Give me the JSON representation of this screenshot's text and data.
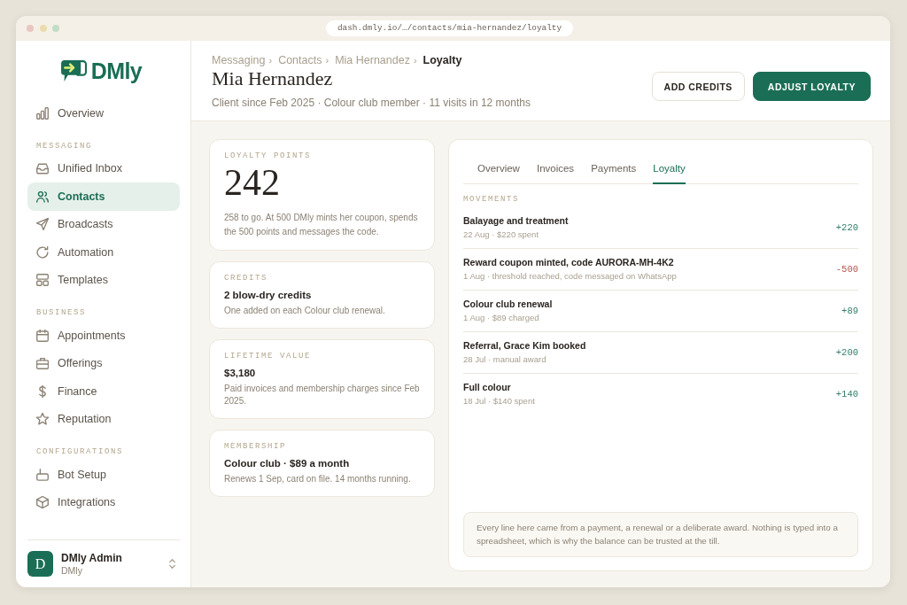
{
  "browser": {
    "address": "dash.dmly.io/…/contacts/mia-hernandez/loyalty"
  },
  "sidebar": {
    "logo": "DMly",
    "items": [
      {
        "label": "Overview",
        "selected": false
      }
    ],
    "sections": [
      {
        "heading": "MESSAGING",
        "items": [
          {
            "label": "Unified Inbox",
            "selected": false
          },
          {
            "label": "Contacts",
            "selected": true
          },
          {
            "label": "Broadcasts",
            "selected": false
          },
          {
            "label": "Automation",
            "selected": false
          },
          {
            "label": "Templates",
            "selected": false
          }
        ]
      },
      {
        "heading": "BUSINESS",
        "items": [
          {
            "label": "Appointments",
            "selected": false
          },
          {
            "label": "Offerings",
            "selected": false
          },
          {
            "label": "Finance",
            "selected": false
          },
          {
            "label": "Reputation",
            "selected": false
          }
        ]
      },
      {
        "heading": "CONFIGURATIONS",
        "items": [
          {
            "label": "Bot Setup",
            "selected": false
          },
          {
            "label": "Integrations",
            "selected": false
          }
        ]
      }
    ],
    "account": {
      "initial": "D",
      "name": "DMly Admin",
      "workspace": "DMly"
    }
  },
  "header": {
    "breadcrumb": [
      {
        "label": "Messaging",
        "separator": "›",
        "current": false
      },
      {
        "label": "Contacts",
        "separator": "›",
        "current": false
      },
      {
        "label": "Mia Hernandez",
        "separator": "›",
        "current": false
      },
      {
        "label": "Loyalty",
        "current": true
      }
    ],
    "title": "Mia Hernandez",
    "subtitle": "Client since Feb 2025 · Colour club member · 11 visits in 12 months",
    "buttons": [
      {
        "label": "ADD CREDITS",
        "kind": "secondary"
      },
      {
        "label": "ADJUST LOYALTY",
        "kind": "primary"
      }
    ]
  },
  "summary_cards": [
    {
      "kind": "points",
      "label": "LOYALTY POINTS",
      "value": "242",
      "description": "258 to go. At 500 DMly mints her coupon, spends the 500 points and messages the code."
    },
    {
      "kind": "stat",
      "label": "CREDITS",
      "value": "2 blow-dry credits",
      "description": "One added on each Colour club renewal."
    },
    {
      "kind": "stat",
      "label": "LIFETIME VALUE",
      "value": "$3,180",
      "description": "Paid invoices and membership charges since Feb 2025."
    },
    {
      "kind": "stat",
      "label": "MEMBERSHIP",
      "value": "Colour club · $89 a month",
      "description": "Renews 1 Sep, card on file. 14 months running."
    }
  ],
  "detail_panel": {
    "tabs": [
      {
        "label": "Overview",
        "selected": false
      },
      {
        "label": "Invoices",
        "selected": false
      },
      {
        "label": "Payments",
        "selected": false
      },
      {
        "label": "Loyalty",
        "selected": true
      }
    ],
    "section_label": "MOVEMENTS",
    "movements": [
      {
        "title": "Balayage and treatment",
        "detail": "22 Aug · $220 spent",
        "amount": "+220",
        "color": "#2e7d68"
      },
      {
        "title": "Reward coupon minted, code AURORA-MH-4K2",
        "detail": "1 Aug · threshold reached, code messaged on WhatsApp",
        "amount": "-500",
        "color": "#b4544a"
      },
      {
        "title": "Colour club renewal",
        "detail": "1 Aug · $89 charged",
        "amount": "+89",
        "color": "#2e7d68"
      },
      {
        "title": "Referral, Grace Kim booked",
        "detail": "28 Jul · manual award",
        "amount": "+200",
        "color": "#2e7d68"
      },
      {
        "title": "Full colour",
        "detail": "18 Jul · $140 spent",
        "amount": "+140",
        "color": "#2e7d68"
      }
    ],
    "note": "Every line here came from a payment, a renewal or a deliberate award. Nothing is typed into a spreadsheet, which is why the balance can be trusted at the till."
  }
}
